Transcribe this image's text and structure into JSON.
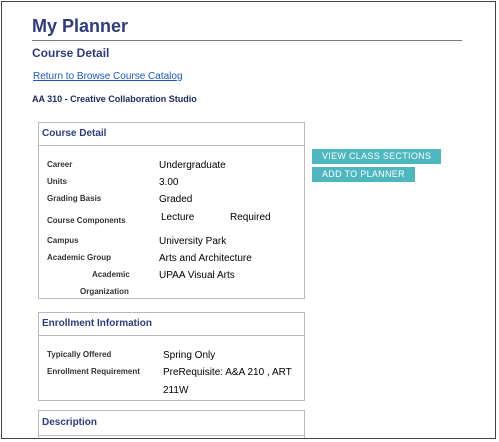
{
  "header": {
    "title": "My Planner",
    "subtitle": "Course Detail",
    "return_link": "Return to Browse Course Catalog",
    "course": "AA  310 - Creative Collaboration Studio"
  },
  "course_detail": {
    "heading": "Course Detail",
    "career_label": "Career",
    "career_value": "Undergraduate",
    "units_label": "Units",
    "units_value": "3.00",
    "grading_label": "Grading Basis",
    "grading_value": "Graded",
    "components_label": "Course Components",
    "component_value": "Lecture",
    "component_status": "Required",
    "campus_label": "Campus",
    "campus_value": "University Park",
    "group_label": "Academic Group",
    "group_value": "Arts and Architecture",
    "org_label_line1": "Academic",
    "org_label_line2": "Organization",
    "org_value": "UPAA Visual Arts"
  },
  "actions": {
    "view_sections": "VIEW CLASS SECTIONS",
    "add_planner": "ADD TO PLANNER"
  },
  "enrollment": {
    "heading": "Enrollment Information",
    "offered_label": "Typically Offered",
    "offered_value": "Spring Only",
    "requirement_label": "Enrollment Requirement",
    "requirement_line1": "PreRequisite:  A&A  210 , ART",
    "requirement_line2": "211W"
  },
  "description": {
    "heading": "Description"
  },
  "colors": {
    "accent": "#2f3b7f",
    "button": "#4db7bf",
    "link": "#1a57c8"
  }
}
